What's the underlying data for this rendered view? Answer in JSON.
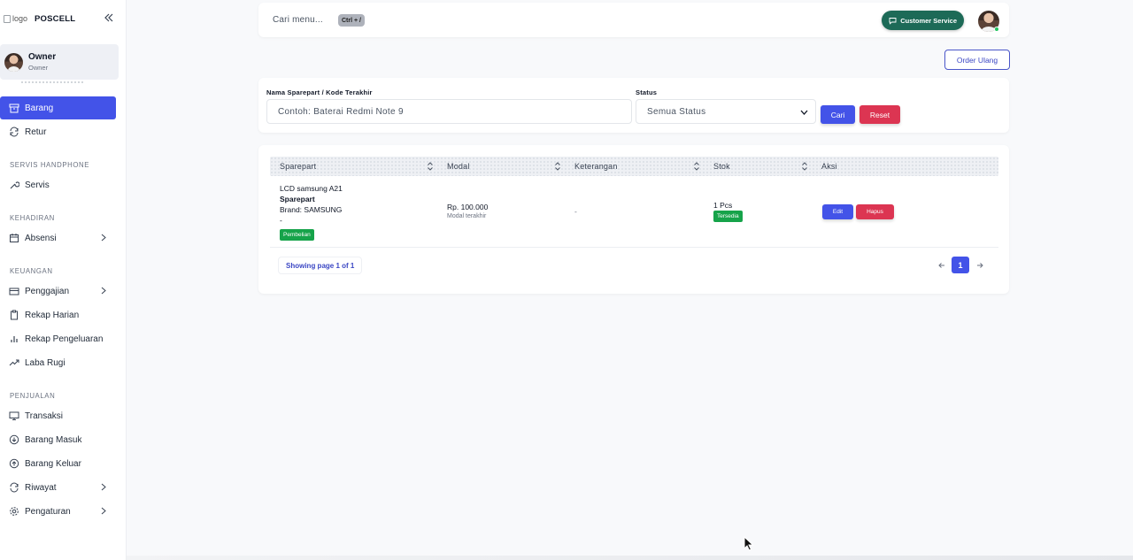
{
  "brand": {
    "logo_alt": "logo",
    "name": "POSCELL"
  },
  "user": {
    "name": "Owner",
    "role": "Owner"
  },
  "nav": {
    "barang": "Barang",
    "retur": "Retur",
    "section_servis": "SERVIS HANDPHONE",
    "servis": "Servis",
    "section_kehadiran": "KEHADIRAN",
    "absensi": "Absensi",
    "section_keuangan": "KEUANGAN",
    "penggajian": "Penggajian",
    "rekap_harian": "Rekap Harian",
    "rekap_pengeluaran": "Rekap Pengeluaran",
    "laba_rugi": "Laba Rugi",
    "section_penjualan": "PENJUALAN",
    "transaksi": "Transaksi",
    "barang_masuk": "Barang Masuk",
    "barang_keluar": "Barang Keluar",
    "riwayat": "Riwayat",
    "pengaturan": "Pengaturan"
  },
  "topbar": {
    "search_placeholder": "Cari menu...",
    "shortcut": "Ctrl + /",
    "customer_service": "Customer Service"
  },
  "actions": {
    "order_ulang": "Order Ulang"
  },
  "filter": {
    "name_label": "Nama Sparepart / Kode Terakhir",
    "name_placeholder": "Contoh: Baterai Redmi Note 9",
    "status_label": "Status",
    "status_value": "Semua Status",
    "search_button": "Cari",
    "reset_button": "Reset"
  },
  "table": {
    "headers": [
      "Sparepart",
      "Modal",
      "Keterangan",
      "Stok",
      "Aksi"
    ],
    "rows": [
      {
        "name": "LCD samsung A21",
        "type": "Sparepart",
        "brand": "Brand: SAMSUNG",
        "extra": "-",
        "tag": "Pembelian",
        "modal": "Rp. 100.000",
        "modal_note": "Modal terakhir",
        "keterangan": "-",
        "stok": "1 Pcs",
        "stok_status": "Tersedia",
        "edit": "Edit",
        "hapus": "Hapus"
      }
    ]
  },
  "pagination": {
    "info": "Showing page 1 of 1",
    "current": "1"
  }
}
